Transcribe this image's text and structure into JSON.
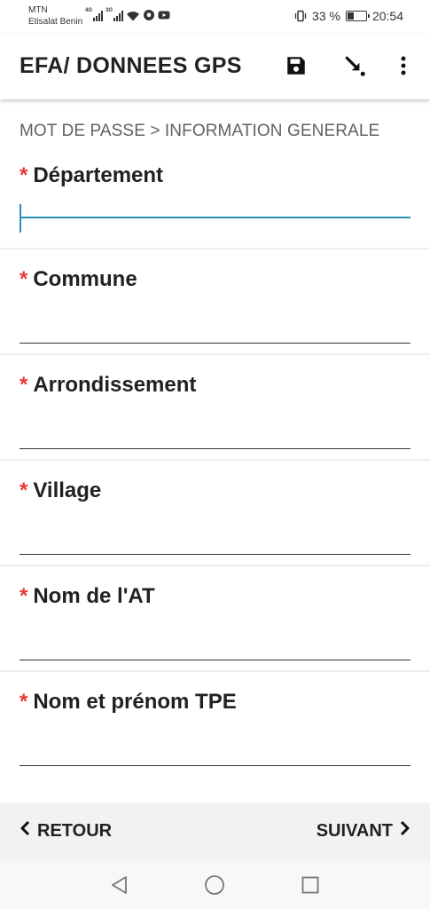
{
  "status_bar": {
    "carrier_1": "MTN",
    "carrier_2": "Etisalat Benin",
    "sim1_network": "4G",
    "sim2_network": "3G",
    "battery_percent": "33 %",
    "battery_level": 0.33,
    "time": "20:54"
  },
  "app_bar": {
    "title": "EFA/ DONNEES GPS",
    "icons": [
      "save-icon",
      "download-icon",
      "more-vert-icon"
    ]
  },
  "breadcrumb": "MOT DE PASSE > INFORMATION GENERALE",
  "required_marker": "*",
  "fields": [
    {
      "label": "Département",
      "value": "",
      "focused": true
    },
    {
      "label": "Commune",
      "value": "",
      "focused": false
    },
    {
      "label": "Arrondissement",
      "value": "",
      "focused": false
    },
    {
      "label": "Village",
      "value": "",
      "focused": false
    },
    {
      "label": "Nom de l'AT",
      "value": "",
      "focused": false
    },
    {
      "label": "Nom et prénom TPE",
      "value": "",
      "focused": false
    }
  ],
  "bottom_nav": {
    "back_label": "RETOUR",
    "next_label": "SUIVANT"
  },
  "colors": {
    "required": "#e53935",
    "focus": "#2a8fb5",
    "bottom_bar": "#f2f2f2"
  }
}
